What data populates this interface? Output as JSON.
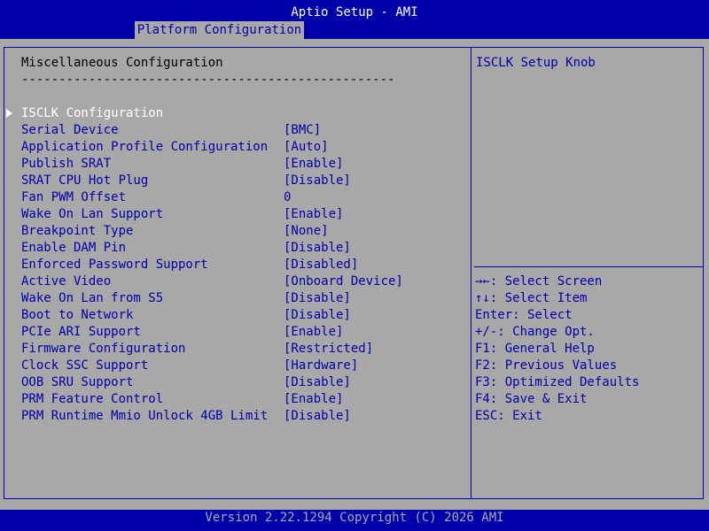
{
  "window": {
    "title": "Aptio Setup - AMI",
    "tab": "Platform Configuration"
  },
  "main": {
    "section_title": "Miscellaneous Configuration",
    "separator": "--------------------------------------------------",
    "submenu": {
      "label": "ISCLK Configuration"
    },
    "options": [
      {
        "label": "Serial Device",
        "value": "[BMC]"
      },
      {
        "label": "Application Profile Configuration",
        "value": "[Auto]"
      },
      {
        "label": "Publish SRAT",
        "value": "[Enable]"
      },
      {
        "label": "SRAT CPU Hot Plug",
        "value": "[Disable]"
      },
      {
        "label": "Fan PWM Offset",
        "value": "0"
      },
      {
        "label": "Wake On Lan Support",
        "value": "[Enable]"
      },
      {
        "label": "Breakpoint Type",
        "value": "[None]"
      },
      {
        "label": "Enable DAM Pin",
        "value": "[Disable]"
      },
      {
        "label": "Enforced Password Support",
        "value": "[Disabled]"
      },
      {
        "label": "Active Video",
        "value": "[Onboard Device]"
      },
      {
        "label": "Wake On Lan from S5",
        "value": "[Disable]"
      },
      {
        "label": "Boot to Network",
        "value": "[Disable]"
      },
      {
        "label": "PCIe ARI Support",
        "value": "[Enable]"
      },
      {
        "label": "Firmware Configuration",
        "value": "[Restricted]"
      },
      {
        "label": "Clock SSC Support",
        "value": "[Hardware]"
      },
      {
        "label": "OOB SRU Support",
        "value": "[Disable]"
      },
      {
        "label": "PRM Feature Control",
        "value": "[Enable]"
      },
      {
        "label": "PRM Runtime Mmio Unlock 4GB Limit",
        "value": "[Disable]"
      }
    ]
  },
  "help": {
    "text": "ISCLK Setup Knob",
    "keys": [
      "→←: Select Screen",
      "↑↓: Select Item",
      "Enter: Select",
      "+/-: Change Opt.",
      "F1: General Help",
      "F2: Previous Values",
      "F3: Optimized Defaults",
      "F4: Save & Exit",
      "ESC: Exit"
    ]
  },
  "footer": {
    "version": "Version 2.22.1294 Copyright (C) 2026 AMI"
  }
}
